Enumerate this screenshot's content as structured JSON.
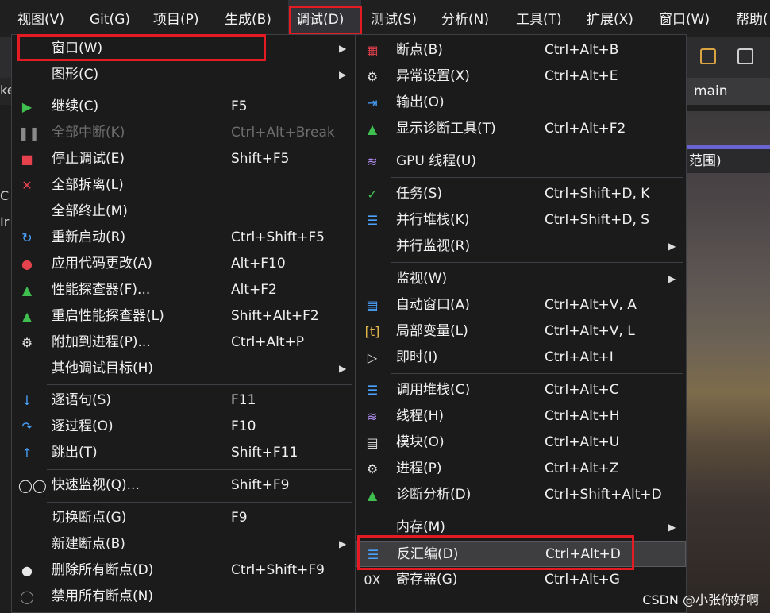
{
  "menubar": {
    "items": [
      "视图(V)",
      "Git(G)",
      "项目(P)",
      "生成(B)",
      "调试(D)",
      "测试(S)",
      "分析(N)",
      "工具(T)",
      "扩展(X)",
      "窗口(W)",
      "帮助("
    ],
    "active": "调试(D)"
  },
  "background": {
    "tab_main": "main",
    "scope_label": "范围)",
    "left_fragments": [
      "ke",
      "C",
      "Ir"
    ],
    "watermark": "CSDN @小张你好啊"
  },
  "debug_menu": {
    "items": [
      {
        "label": "窗口(W)",
        "shortcut": "",
        "submenu": true,
        "icon": "none"
      },
      {
        "label": "图形(C)",
        "shortcut": "",
        "submenu": true,
        "icon": "none"
      },
      {
        "label": "继续(C)",
        "shortcut": "F5",
        "icon": "play-icon"
      },
      {
        "label": "全部中断(K)",
        "shortcut": "Ctrl+Alt+Break",
        "disabled": true,
        "icon": "pause-icon"
      },
      {
        "label": "停止调试(E)",
        "shortcut": "Shift+F5",
        "icon": "stop-icon"
      },
      {
        "label": "全部拆离(L)",
        "shortcut": "",
        "icon": "detach-icon"
      },
      {
        "label": "全部终止(M)",
        "shortcut": "",
        "icon": "none"
      },
      {
        "label": "重新启动(R)",
        "shortcut": "Ctrl+Shift+F5",
        "icon": "restart-icon"
      },
      {
        "label": "应用代码更改(A)",
        "shortcut": "Alt+F10",
        "icon": "hot-reload-icon"
      },
      {
        "label": "性能探查器(F)...",
        "shortcut": "Alt+F2",
        "icon": "profiler-icon"
      },
      {
        "label": "重启性能探查器(L)",
        "shortcut": "Shift+Alt+F2",
        "icon": "profiler-icon"
      },
      {
        "label": "附加到进程(P)...",
        "shortcut": "Ctrl+Alt+P",
        "icon": "gears-icon"
      },
      {
        "label": "其他调试目标(H)",
        "shortcut": "",
        "submenu": true,
        "icon": "none"
      },
      {
        "label": "逐语句(S)",
        "shortcut": "F11",
        "icon": "step-into-icon"
      },
      {
        "label": "逐过程(O)",
        "shortcut": "F10",
        "icon": "step-over-icon"
      },
      {
        "label": "跳出(T)",
        "shortcut": "Shift+F11",
        "icon": "step-out-icon"
      },
      {
        "label": "快速监视(Q)...",
        "shortcut": "Shift+F9",
        "icon": "glasses-icon"
      },
      {
        "label": "切换断点(G)",
        "shortcut": "F9",
        "icon": "none"
      },
      {
        "label": "新建断点(B)",
        "shortcut": "",
        "submenu": true,
        "icon": "none"
      },
      {
        "label": "删除所有断点(D)",
        "shortcut": "Ctrl+Shift+F9",
        "icon": "delete-breakpoints-icon"
      },
      {
        "label": "禁用所有断点(N)",
        "shortcut": "",
        "icon": "disable-breakpoints-icon"
      }
    ]
  },
  "window_submenu": {
    "items": [
      {
        "label": "断点(B)",
        "shortcut": "Ctrl+Alt+B",
        "icon": "breakpoints-window-icon"
      },
      {
        "label": "异常设置(X)",
        "shortcut": "Ctrl+Alt+E",
        "icon": "exception-settings-icon"
      },
      {
        "label": "输出(O)",
        "shortcut": "",
        "icon": "output-icon"
      },
      {
        "label": "显示诊断工具(T)",
        "shortcut": "Ctrl+Alt+F2",
        "icon": "diagnostics-icon"
      },
      {
        "label": "GPU 线程(U)",
        "shortcut": "",
        "icon": "gpu-threads-icon"
      },
      {
        "label": "任务(S)",
        "shortcut": "Ctrl+Shift+D, K",
        "icon": "tasks-icon"
      },
      {
        "label": "并行堆栈(K)",
        "shortcut": "Ctrl+Shift+D, S",
        "icon": "parallel-stacks-icon"
      },
      {
        "label": "并行监视(R)",
        "shortcut": "",
        "submenu": true,
        "icon": "none"
      },
      {
        "label": "监视(W)",
        "shortcut": "",
        "submenu": true,
        "icon": "none"
      },
      {
        "label": "自动窗口(A)",
        "shortcut": "Ctrl+Alt+V, A",
        "icon": "autos-icon"
      },
      {
        "label": "局部变量(L)",
        "shortcut": "Ctrl+Alt+V, L",
        "icon": "locals-icon"
      },
      {
        "label": "即时(I)",
        "shortcut": "Ctrl+Alt+I",
        "icon": "immediate-icon"
      },
      {
        "label": "调用堆栈(C)",
        "shortcut": "Ctrl+Alt+C",
        "icon": "call-stack-icon"
      },
      {
        "label": "线程(H)",
        "shortcut": "Ctrl+Alt+H",
        "icon": "threads-icon"
      },
      {
        "label": "模块(O)",
        "shortcut": "Ctrl+Alt+U",
        "icon": "modules-icon"
      },
      {
        "label": "进程(P)",
        "shortcut": "Ctrl+Alt+Z",
        "icon": "processes-icon"
      },
      {
        "label": "诊断分析(D)",
        "shortcut": "Ctrl+Shift+Alt+D",
        "icon": "diagnostic-analysis-icon"
      },
      {
        "label": "内存(M)",
        "shortcut": "",
        "submenu": true,
        "icon": "none"
      },
      {
        "label": "反汇编(D)",
        "shortcut": "Ctrl+Alt+D",
        "highlighted": true,
        "icon": "disassembly-icon"
      },
      {
        "label": "寄存器(G)",
        "shortcut": "Ctrl+Alt+G",
        "icon": "registers-icon"
      }
    ]
  }
}
